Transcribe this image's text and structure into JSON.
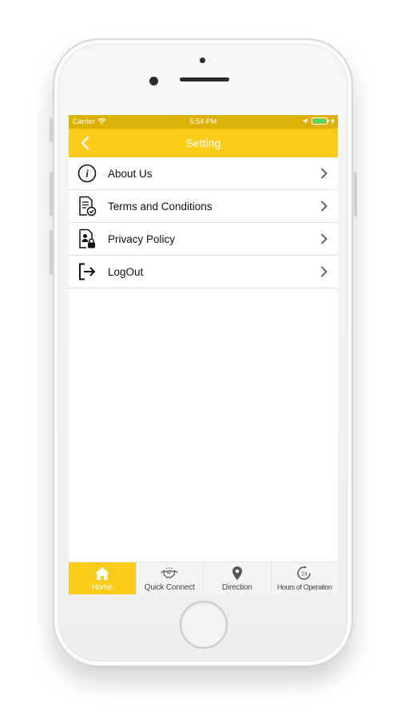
{
  "status_bar": {
    "carrier": "Carrier",
    "time": "5:54 PM"
  },
  "nav": {
    "title": "Setting"
  },
  "menu": {
    "items": [
      {
        "label": "About Us",
        "icon": "info-icon"
      },
      {
        "label": "Terms and Conditions",
        "icon": "document-check-icon"
      },
      {
        "label": "Privacy Policy",
        "icon": "privacy-document-icon"
      },
      {
        "label": "LogOut",
        "icon": "logout-icon"
      }
    ]
  },
  "tabs": [
    {
      "label": "Home",
      "icon": "home-icon",
      "active": true
    },
    {
      "label": "Quick Connect",
      "icon": "handshake-icon",
      "active": false
    },
    {
      "label": "Direction",
      "icon": "location-pin-icon",
      "active": false
    },
    {
      "label": "Hours of Operation",
      "icon": "clock-24-icon",
      "active": false
    }
  ],
  "colors": {
    "accent": "#f9cc1a",
    "status_bar": "#dcb007",
    "battery": "#4cd964"
  }
}
